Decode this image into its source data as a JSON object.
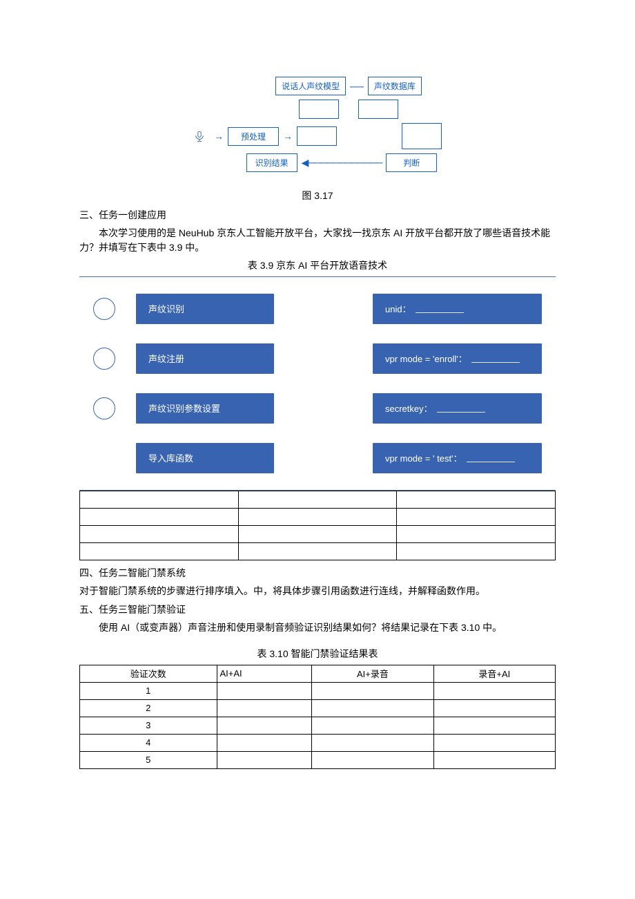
{
  "diagram": {
    "top_left": "说话人声纹模型",
    "top_right": "声纹数据库",
    "mid_pre": "预处理",
    "bot_left": "识别结果",
    "bot_right": "判断",
    "caption": "图 3.17"
  },
  "sec3": {
    "heading": "三、任务一创建应用",
    "para": "本次学习使用的是 NeuHub 京东人工智能开放平台，大家找一找京东 AI 开放平台都开放了哪些语音技术能力？并填写在下表中 3.9 中。",
    "table_caption": "表 3.9 京东 AI 平台开放语音技术"
  },
  "bluezone": {
    "rows": [
      {
        "left": "声纹识别",
        "right_prefix": "unid：",
        "right_suffix": ""
      },
      {
        "left": "声纹注册",
        "right_prefix": "vpr mode = 'enroll'：",
        "right_suffix": ""
      },
      {
        "left": "声纹识别参数设置",
        "right_prefix": "secretkey：",
        "right_suffix": ""
      },
      {
        "left": "导入库函数",
        "right_prefix": "vpr mode = ' test'：",
        "right_suffix": "",
        "no_circle": true
      }
    ]
  },
  "sec4": {
    "heading": "四、任务二智能门禁系统",
    "para": "对于智能门禁系统的步骤进行排序填入。中，将具体步骤引用函数进行连线，并解释函数作用。"
  },
  "sec5": {
    "heading": "五、任务三智能门禁验证",
    "para": "使用 AI（或变声器）声音注册和使用录制音频验证识别结果如何？将结果记录在下表 3.10 中。"
  },
  "t310": {
    "caption": "表 3.10 智能门禁验证结果表",
    "headers": [
      "验证次数",
      "AI+AI",
      "AI+录音",
      "录音+AI"
    ],
    "rows": [
      "1",
      "2",
      "3",
      "4",
      "5"
    ]
  }
}
